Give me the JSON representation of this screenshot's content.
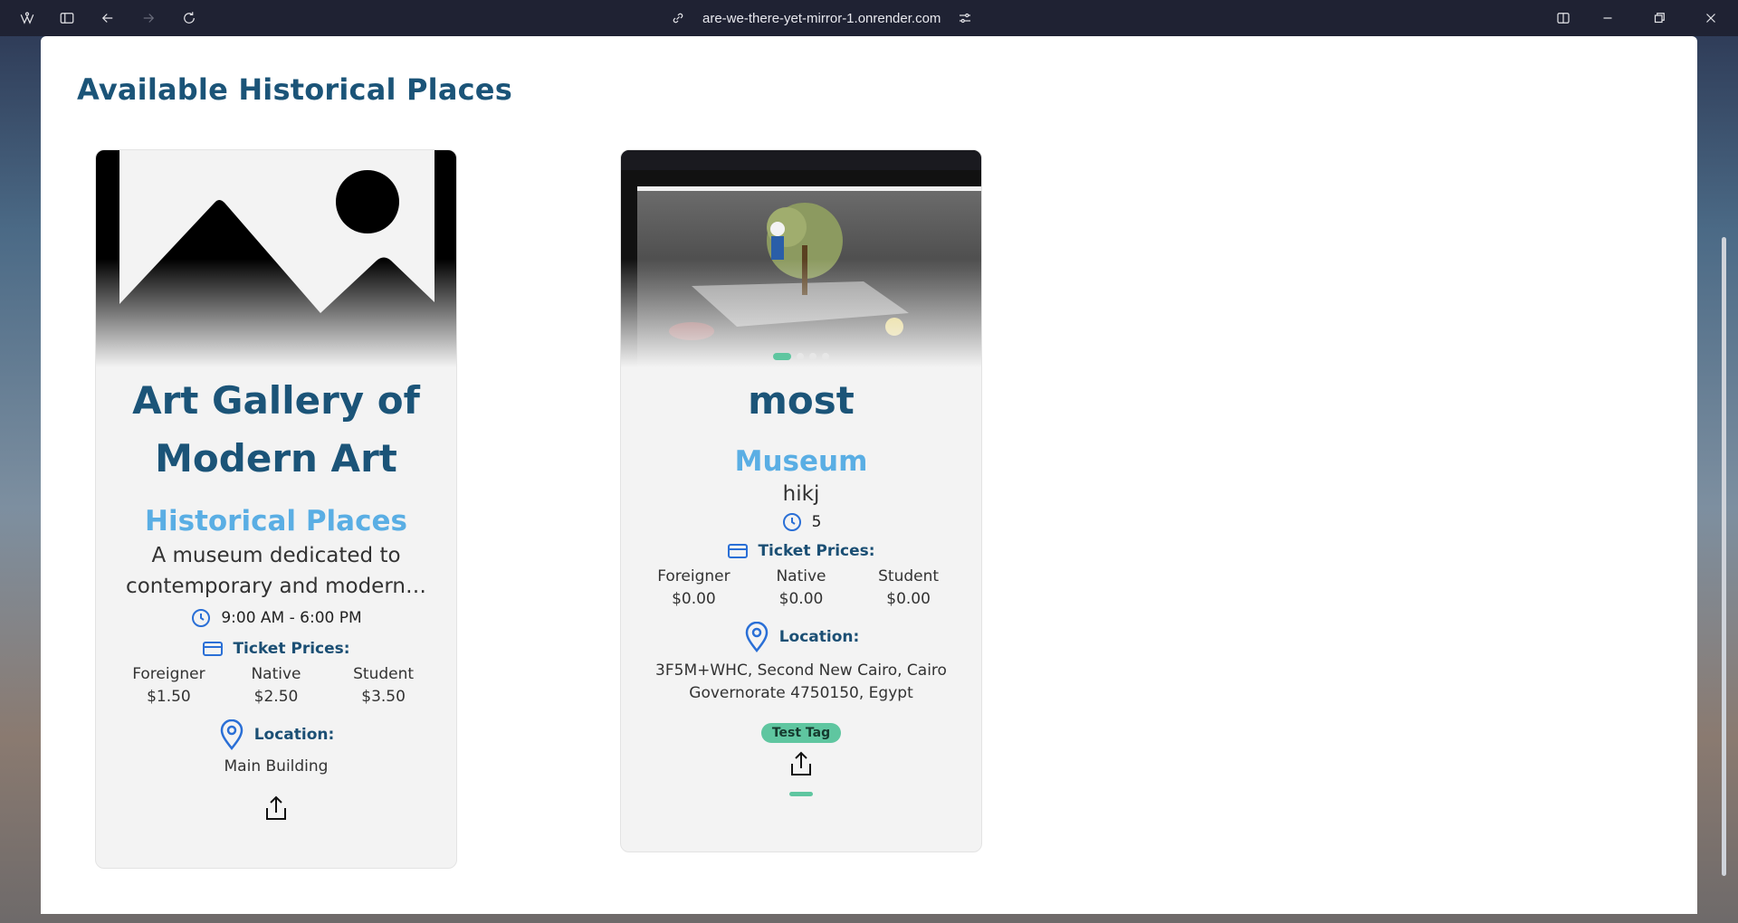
{
  "browser": {
    "url": "are-we-there-yet-mirror-1.onrender.com"
  },
  "page": {
    "title": "Available Historical Places"
  },
  "cards": [
    {
      "name": "Art Gallery of Modern Art",
      "category": "Historical Places",
      "description": "A museum dedicated to contemporary and modern…",
      "hours": "9:00 AM - 6:00 PM",
      "ticket_label": "Ticket Prices:",
      "prices": [
        {
          "label": "Foreigner",
          "value": "$1.50"
        },
        {
          "label": "Native",
          "value": "$2.50"
        },
        {
          "label": "Student",
          "value": "$3.50"
        }
      ],
      "location_label": "Location:",
      "location": "Main Building"
    },
    {
      "name": "most",
      "category": "Museum",
      "description": "hikj",
      "hours": "5",
      "ticket_label": "Ticket Prices:",
      "prices": [
        {
          "label": "Foreigner",
          "value": "$0.00"
        },
        {
          "label": "Native",
          "value": "$0.00"
        },
        {
          "label": "Student",
          "value": "$0.00"
        }
      ],
      "location_label": "Location:",
      "location": "3F5M+WHC, Second New Cairo, Cairo Governorate 4750150, Egypt",
      "tag": "Test Tag",
      "image_slides": 4,
      "active_slide": 1
    }
  ],
  "colors": {
    "title": "#1b5478",
    "category": "#5aaee4",
    "accent": "#5fc6a0",
    "icon_blue": "#2a6fd6"
  }
}
